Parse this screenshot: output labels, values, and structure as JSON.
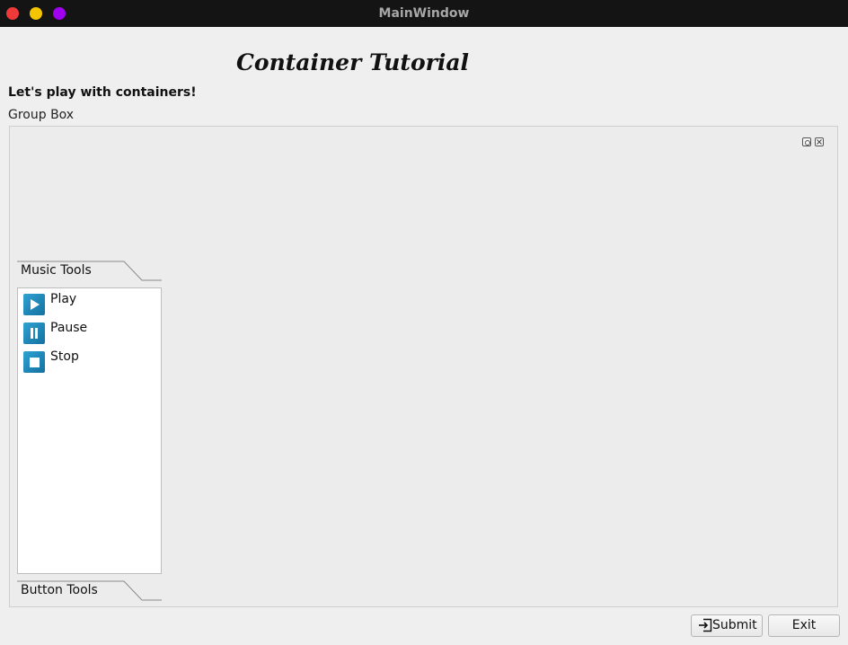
{
  "window": {
    "title": "MainWindow"
  },
  "main": {
    "heading": "Container Tutorial",
    "subheading": "Let's play with containers!",
    "group_box_title": "Group Box"
  },
  "toolbox": {
    "tabs": [
      {
        "label": "Music Tools",
        "expanded": true,
        "items": [
          {
            "label": "Play",
            "icon": "play-icon"
          },
          {
            "label": "Pause",
            "icon": "pause-icon"
          },
          {
            "label": "Stop",
            "icon": "stop-icon"
          }
        ]
      },
      {
        "label": "Button Tools",
        "expanded": false
      }
    ]
  },
  "buttons": {
    "submit_label": "Submit",
    "exit_label": "Exit"
  },
  "colors": {
    "titlebar": "#141414",
    "close": "#f03a3a",
    "minimize": "#f5c400",
    "maximize": "#a100f0",
    "icon_blue": "#1f86b7"
  }
}
